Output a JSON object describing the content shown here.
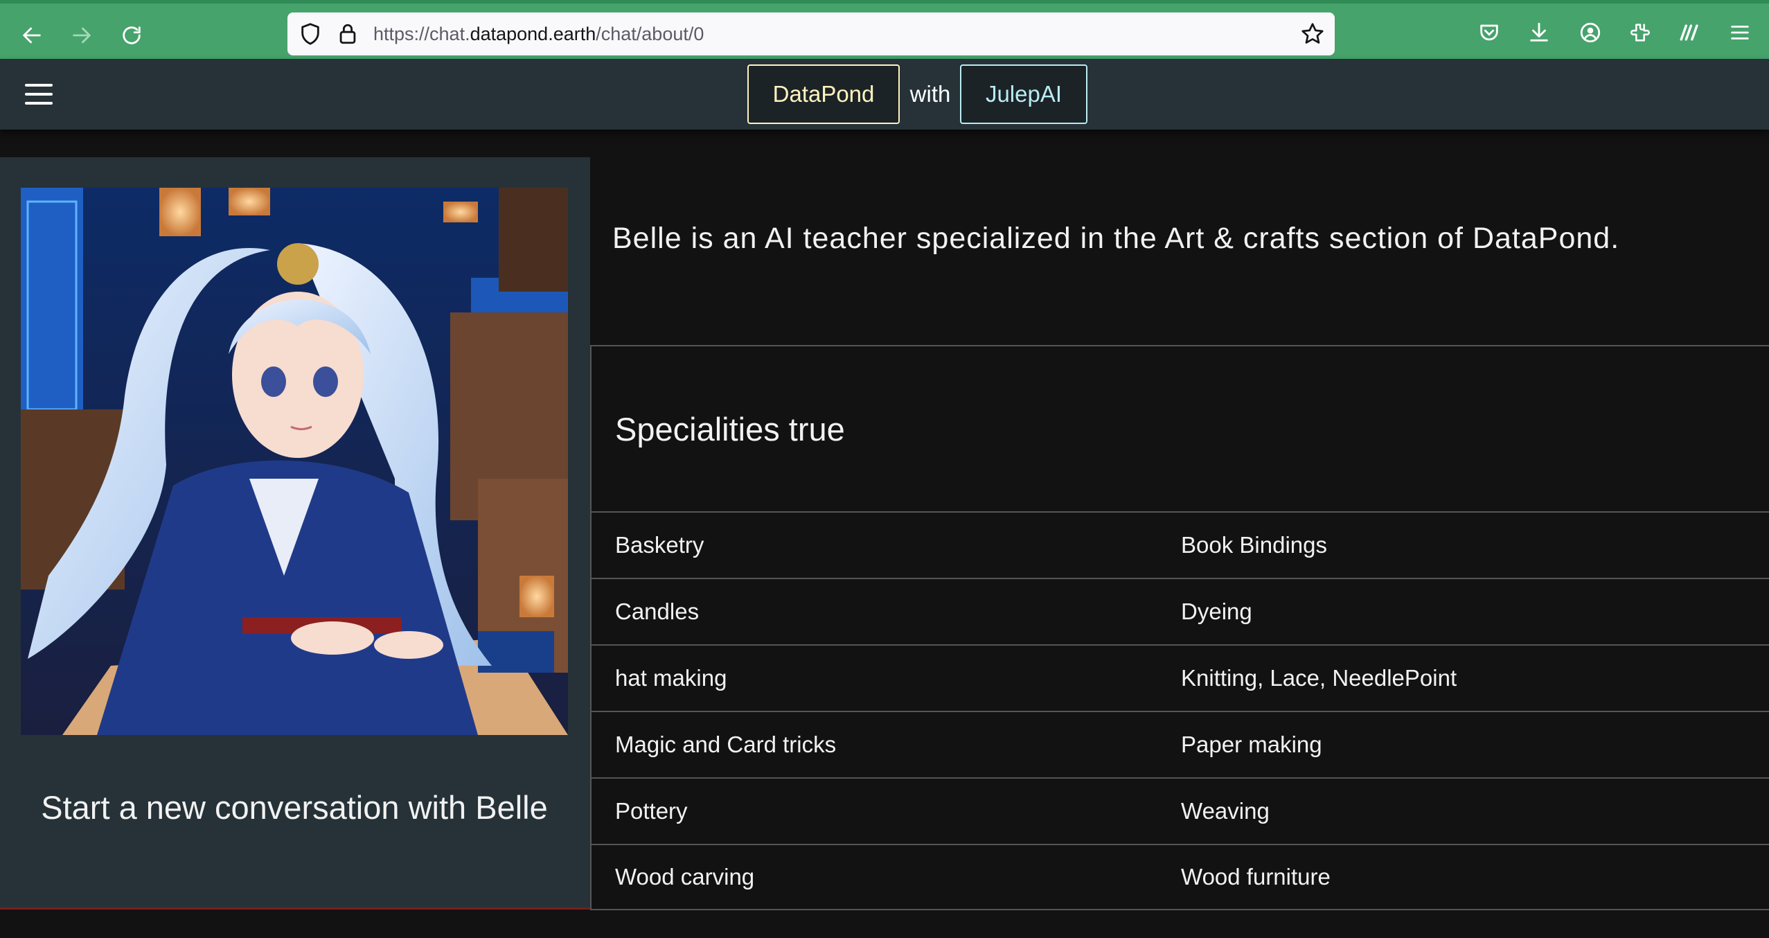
{
  "browser": {
    "url_prefix": "https://chat.",
    "url_host": "datapond.earth",
    "url_path": "/chat/about/0"
  },
  "header": {
    "brand_left": "DataPond",
    "brand_joiner": "with",
    "brand_right": "JulepAI"
  },
  "agent": {
    "start_conversation_label": "Start a new conversation with Belle",
    "description": "Belle is an AI teacher specialized in the Art & crafts section of DataPond."
  },
  "specialities": {
    "title": "Specialities true",
    "rows": [
      [
        "Basketry",
        "Book Bindings"
      ],
      [
        "Candles",
        "Dyeing"
      ],
      [
        "hat making",
        "Knitting, Lace, NeedlePoint"
      ],
      [
        "Magic and Card tricks",
        "Paper making"
      ],
      [
        "Pottery",
        "Weaving"
      ],
      [
        "Wood carving",
        "Wood furniture"
      ]
    ]
  },
  "colors": {
    "browser_accent": "#46a36c",
    "header_bg": "#263238",
    "page_bg": "#121212",
    "datapond_accent": "#fff3bf",
    "julep_accent": "#b8ecf2"
  }
}
